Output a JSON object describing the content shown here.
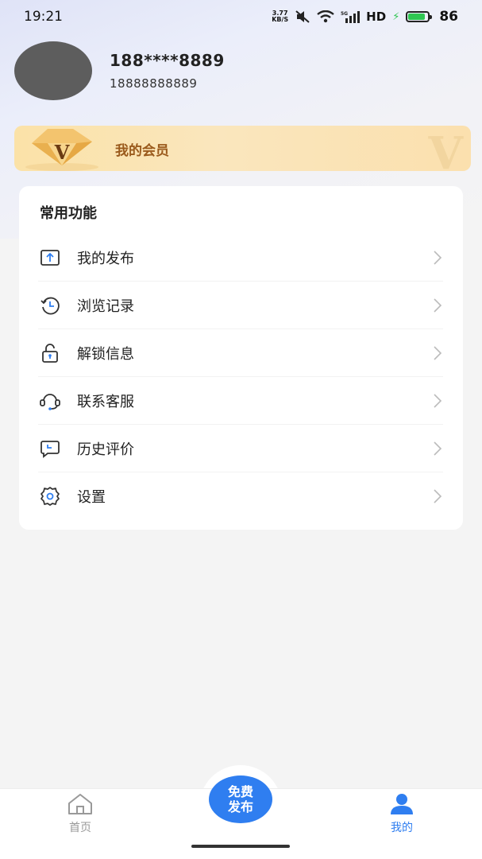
{
  "status_bar": {
    "time": "19:21",
    "net_speed_value": "3.77",
    "net_speed_unit": "KB/S",
    "network": "HD",
    "battery": "86",
    "battery_level": 0.86
  },
  "profile": {
    "name": "188****8889",
    "phone": "18888888889"
  },
  "member": {
    "label": "我的会员"
  },
  "functions": {
    "title": "常用功能",
    "items": [
      {
        "label": "我的发布",
        "icon": "upload-icon"
      },
      {
        "label": "浏览记录",
        "icon": "history-icon"
      },
      {
        "label": "解锁信息",
        "icon": "unlock-icon"
      },
      {
        "label": "联系客服",
        "icon": "headset-icon"
      },
      {
        "label": "历史评价",
        "icon": "comment-icon"
      },
      {
        "label": "设置",
        "icon": "gear-icon"
      }
    ]
  },
  "tabbar": {
    "home": "首页",
    "publish_line1": "免费",
    "publish_line2": "发布",
    "mine": "我的",
    "active": "mine"
  },
  "colors": {
    "accent": "#2f7ef0",
    "member_text": "#9a5a1c",
    "battery": "#2fc652"
  }
}
